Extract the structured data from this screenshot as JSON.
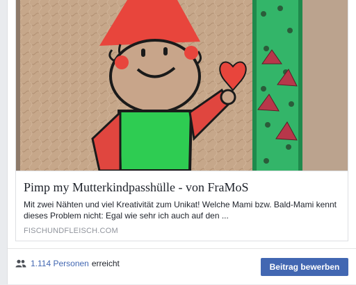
{
  "link_preview": {
    "image_description": "Bestickte Mutterkindpass-Hülle mit Zwerg-Figur und Webband",
    "title": "Pimp my Mutterkindpasshülle - von FraMoS",
    "description": "Mit zwei Nähten und viel Kreativität zum Unikat! Welche Mami bzw. Bald-Mami kennt dieses Problem nicht: Egal wie sehr ich auch auf den ...",
    "domain": "FISCHUNDFLEISCH.COM"
  },
  "footer": {
    "reach_icon": "people-icon",
    "reach_count": "1.114 Personen",
    "reach_suffix": "erreicht",
    "boost_label": "Beitrag bewerben"
  },
  "colors": {
    "link_blue": "#4267b2",
    "button_bg": "#4267b2",
    "meta_gray": "#90949c"
  }
}
